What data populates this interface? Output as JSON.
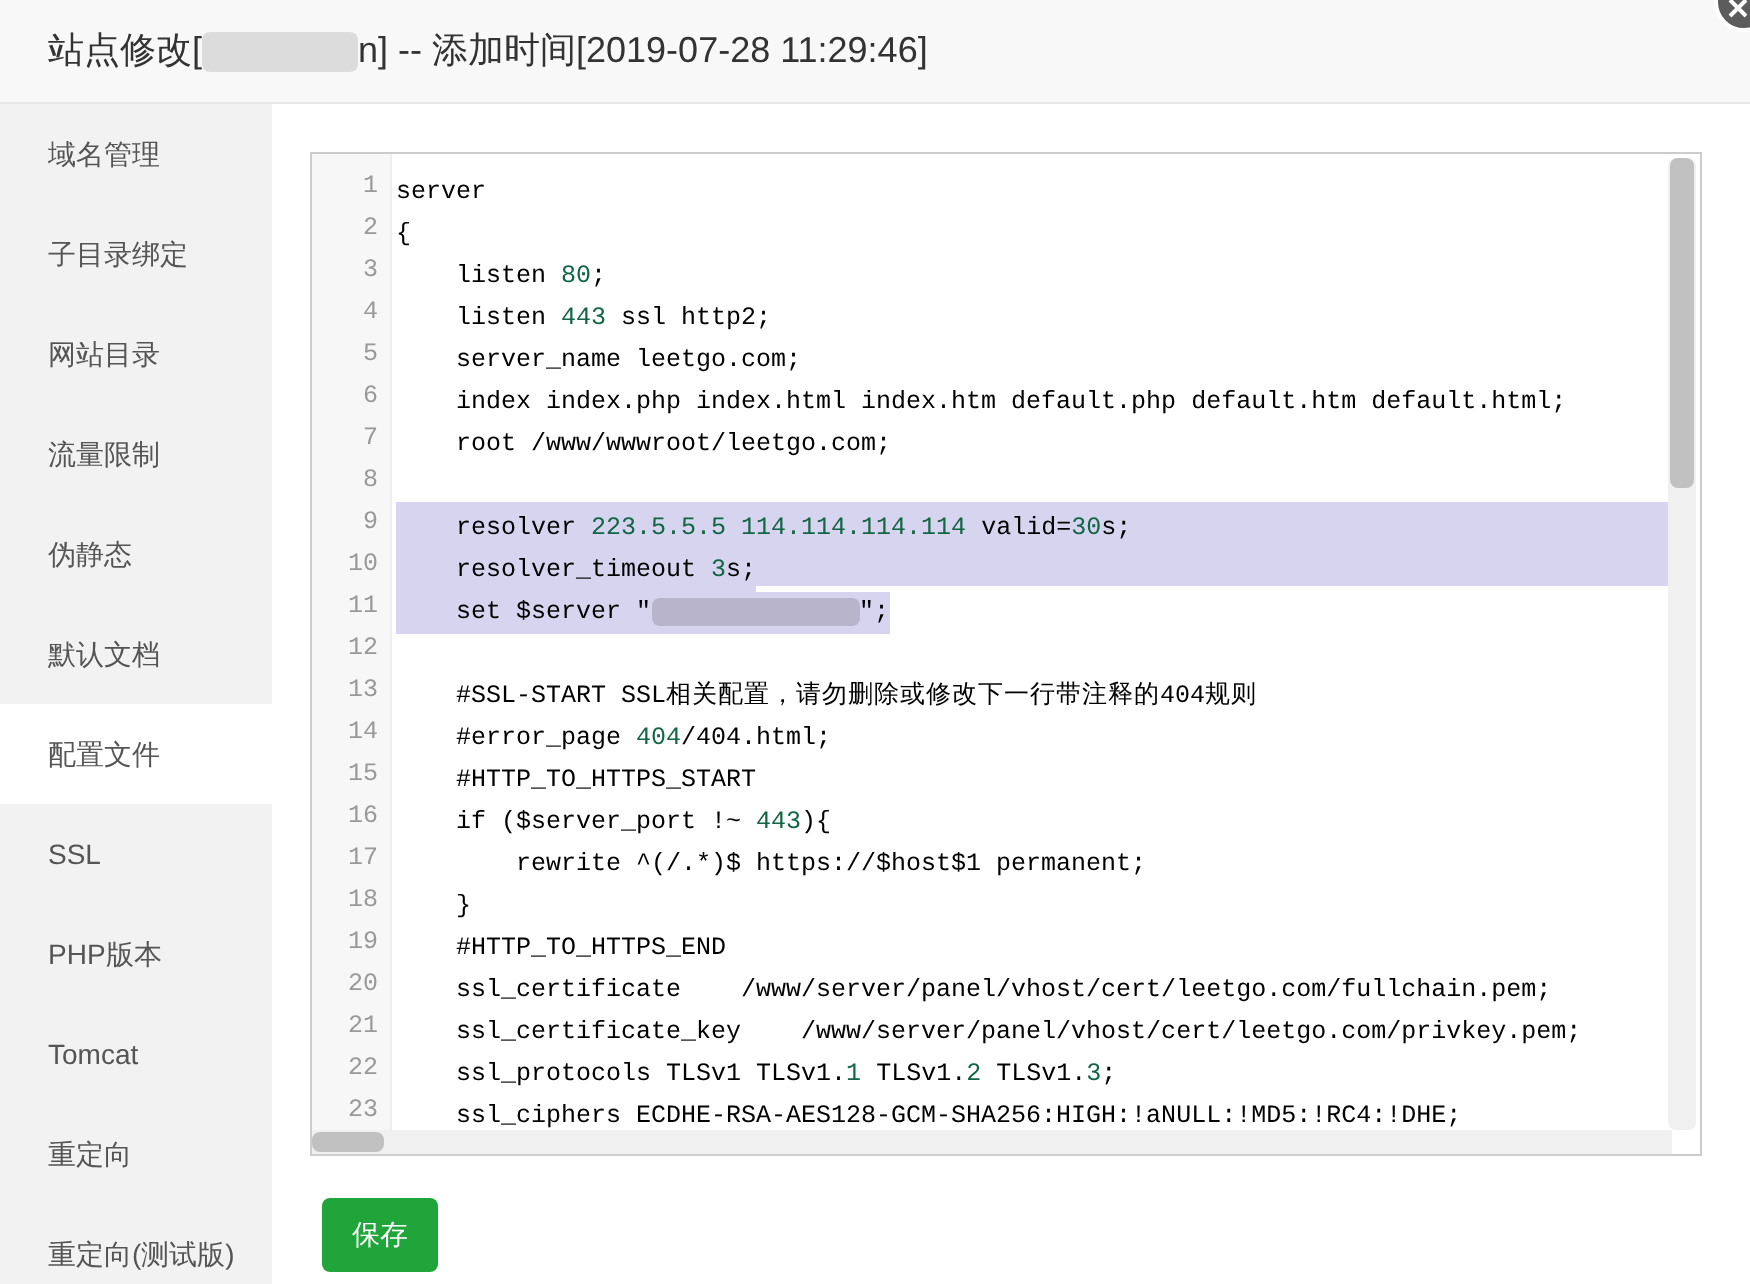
{
  "dialog": {
    "title_before": "站点修改[",
    "title_after": "n] -- 添加时间[2019-07-28 11:29:46]"
  },
  "sidebar": {
    "items": [
      {
        "label": "域名管理",
        "selected": false
      },
      {
        "label": "子目录绑定",
        "selected": false
      },
      {
        "label": "网站目录",
        "selected": false
      },
      {
        "label": "流量限制",
        "selected": false
      },
      {
        "label": "伪静态",
        "selected": false
      },
      {
        "label": "默认文档",
        "selected": false
      },
      {
        "label": "配置文件",
        "selected": true
      },
      {
        "label": "SSL",
        "selected": false
      },
      {
        "label": "PHP版本",
        "selected": false
      },
      {
        "label": "Tomcat",
        "selected": false
      },
      {
        "label": "重定向",
        "selected": false
      },
      {
        "label": "重定向(测试版)",
        "selected": false
      }
    ]
  },
  "editor": {
    "lines": [
      {
        "number": "1",
        "selected": false,
        "segments": [
          {
            "kind": "plain",
            "text": "server"
          }
        ]
      },
      {
        "number": "2",
        "selected": false,
        "segments": [
          {
            "kind": "plain",
            "text": "{"
          }
        ]
      },
      {
        "number": "3",
        "selected": false,
        "segments": [
          {
            "kind": "plain",
            "text": "    listen "
          },
          {
            "kind": "number",
            "text": "80"
          },
          {
            "kind": "plain",
            "text": ";"
          }
        ]
      },
      {
        "number": "4",
        "selected": false,
        "segments": [
          {
            "kind": "plain",
            "text": "    listen "
          },
          {
            "kind": "number",
            "text": "443"
          },
          {
            "kind": "plain",
            "text": " ssl http2;"
          }
        ]
      },
      {
        "number": "5",
        "selected": false,
        "segments": [
          {
            "kind": "plain",
            "text": "    server_name leetgo.com;"
          }
        ]
      },
      {
        "number": "6",
        "selected": false,
        "segments": [
          {
            "kind": "plain",
            "text": "    index index.php index.html index.htm default.php default.htm default.html;"
          }
        ]
      },
      {
        "number": "7",
        "selected": false,
        "segments": [
          {
            "kind": "plain",
            "text": "    root /www/wwwroot/leetgo.com;"
          }
        ]
      },
      {
        "number": "8",
        "selected": false
      },
      {
        "number": "9",
        "selected": true,
        "segments": [
          {
            "kind": "plain",
            "text": "    resolver "
          },
          {
            "kind": "number",
            "text": "223.5.5.5 114.114.114.114"
          },
          {
            "kind": "plain",
            "text": " valid="
          },
          {
            "kind": "number",
            "text": "30"
          },
          {
            "kind": "plain",
            "text": "s;"
          }
        ]
      },
      {
        "number": "10",
        "selected": true,
        "segments": [
          {
            "kind": "plain",
            "text": "    resolver_timeout "
          },
          {
            "kind": "number",
            "text": "3"
          },
          {
            "kind": "plain",
            "text": "s;"
          }
        ]
      },
      {
        "number": "11",
        "selected": true,
        "segments": [
          {
            "kind": "plain",
            "text": "    set $server \""
          },
          {
            "kind": "redacted"
          },
          {
            "kind": "plain",
            "text": "\";"
          }
        ]
      },
      {
        "number": "12",
        "selected": false
      },
      {
        "number": "13",
        "selected": false,
        "segments": [
          {
            "kind": "plain",
            "text": "    #SSL-START SSL相关配置，请勿删除或修改下一行带注释的404规则"
          }
        ]
      },
      {
        "number": "14",
        "selected": false,
        "segments": [
          {
            "kind": "plain",
            "text": "    #error_page "
          },
          {
            "kind": "number",
            "text": "404"
          },
          {
            "kind": "plain",
            "text": "/404.html;"
          }
        ]
      },
      {
        "number": "15",
        "selected": false,
        "segments": [
          {
            "kind": "plain",
            "text": "    #HTTP_TO_HTTPS_START"
          }
        ]
      },
      {
        "number": "16",
        "selected": false,
        "segments": [
          {
            "kind": "plain",
            "text": "    if ($server_port !~ "
          },
          {
            "kind": "number",
            "text": "443"
          },
          {
            "kind": "plain",
            "text": "){"
          }
        ]
      },
      {
        "number": "17",
        "selected": false,
        "segments": [
          {
            "kind": "plain",
            "text": "        rewrite ^(/.*)$ https://$host$1 permanent;"
          }
        ]
      },
      {
        "number": "18",
        "selected": false,
        "segments": [
          {
            "kind": "plain",
            "text": "    }"
          }
        ]
      },
      {
        "number": "19",
        "selected": false,
        "segments": [
          {
            "kind": "plain",
            "text": "    #HTTP_TO_HTTPS_END"
          }
        ]
      },
      {
        "number": "20",
        "selected": false,
        "segments": [
          {
            "kind": "plain",
            "text": "    ssl_certificate    /www/server/panel/vhost/cert/leetgo.com/fullchain.pem;"
          }
        ]
      },
      {
        "number": "21",
        "selected": false,
        "segments": [
          {
            "kind": "plain",
            "text": "    ssl_certificate_key    /www/server/panel/vhost/cert/leetgo.com/privkey.pem;"
          }
        ]
      },
      {
        "number": "22",
        "selected": false,
        "segments": [
          {
            "kind": "plain",
            "text": "    ssl_protocols TLSv1 TLSv1."
          },
          {
            "kind": "number",
            "text": "1"
          },
          {
            "kind": "plain",
            "text": " TLSv1."
          },
          {
            "kind": "number",
            "text": "2"
          },
          {
            "kind": "plain",
            "text": " TLSv1."
          },
          {
            "kind": "number",
            "text": "3"
          },
          {
            "kind": "plain",
            "text": ";"
          }
        ]
      },
      {
        "number": "23",
        "selected": false,
        "segments": [
          {
            "kind": "plain",
            "text": "    ssl_ciphers ECDHE-RSA-AES128-GCM-SHA256:HIGH:!aNULL:!MD5:!RC4:!DHE;"
          }
        ]
      }
    ]
  },
  "save_button": "保存"
}
